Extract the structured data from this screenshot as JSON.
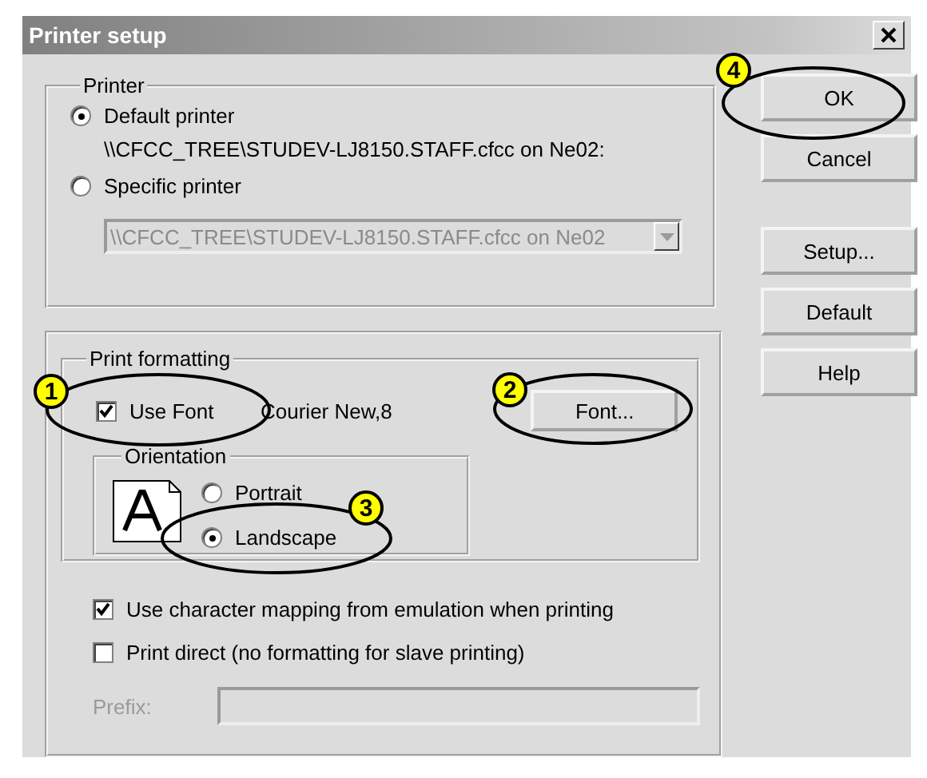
{
  "window": {
    "title": "Printer setup"
  },
  "printer": {
    "label": "Printer",
    "options": [
      {
        "label": "Default printer",
        "selected": true,
        "detail": "\\\\CFCC_TREE\\STUDEV-LJ8150.STAFF.cfcc on Ne02:"
      },
      {
        "label": "Specific printer",
        "selected": false
      }
    ],
    "dropdown": {
      "value": "\\\\CFCC_TREE\\STUDEV-LJ8150.STAFF.cfcc on Ne02",
      "disabled": true
    }
  },
  "buttons": [
    "OK",
    "Cancel",
    "Setup...",
    "Default",
    "Help"
  ],
  "print_formatting": {
    "label": "Print formatting",
    "use_font": {
      "label": "Use Font",
      "checked": true
    },
    "font_name": "Courier New,8",
    "font_button": "Font...",
    "orientation": {
      "label": "Orientation",
      "options": [
        {
          "label": "Portrait",
          "selected": false
        },
        {
          "label": "Landscape",
          "selected": true
        }
      ]
    }
  },
  "options": [
    {
      "label": "Use character mapping from emulation when printing",
      "checked": true
    },
    {
      "label": "Print direct (no formatting for slave printing)",
      "checked": false
    }
  ],
  "prefix": {
    "label": "Prefix:",
    "disabled": true
  },
  "callouts": [
    "1",
    "2",
    "3",
    "4"
  ]
}
